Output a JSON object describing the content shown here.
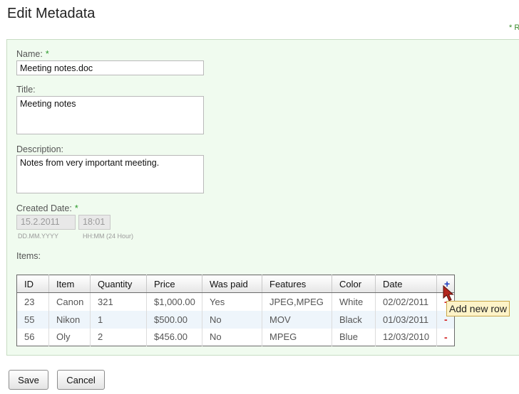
{
  "header": {
    "title": "Edit Metadata",
    "required_note": "* R"
  },
  "form": {
    "name": {
      "label": "Name:",
      "required_marker": "*",
      "value": "Meeting notes.doc"
    },
    "title": {
      "label": "Title:",
      "value": "Meeting notes"
    },
    "description": {
      "label": "Description:",
      "value": "Notes from very important meeting."
    },
    "created_date": {
      "label": "Created Date:",
      "required_marker": "*",
      "date_value": "15.2.2011",
      "time_value": "18:01",
      "date_hint": "DD.MM.YYYY",
      "time_hint": "HH:MM (24 Hour)"
    },
    "items": {
      "label": "Items:",
      "columns": [
        "ID",
        "Item",
        "Quantity",
        "Price",
        "Was paid",
        "Features",
        "Color",
        "Date"
      ],
      "add_symbol": "+",
      "remove_symbol": "-",
      "rows": [
        [
          "23",
          "Canon",
          "321",
          "$1,000.00",
          "Yes",
          "JPEG,MPEG",
          "White",
          "02/02/2011"
        ],
        [
          "55",
          "Nikon",
          "1",
          "$500.00",
          "No",
          "MOV",
          "Black",
          "01/03/2011"
        ],
        [
          "56",
          "Oly",
          "2",
          "$456.00",
          "No",
          "MPEG",
          "Blue",
          "12/03/2010"
        ]
      ]
    }
  },
  "tooltip": {
    "text": "Add new row"
  },
  "buttons": {
    "save": "Save",
    "cancel": "Cancel"
  },
  "colors": {
    "panel_bg": "#f0fbef",
    "required": "#2a9a2a",
    "add": "#1f3dbf",
    "remove": "#d21f1f",
    "tooltip_bg": "#fdf3c8"
  },
  "icons": {
    "add": "plus-icon",
    "remove": "minus-icon",
    "cursor": "mouse-pointer-icon"
  }
}
